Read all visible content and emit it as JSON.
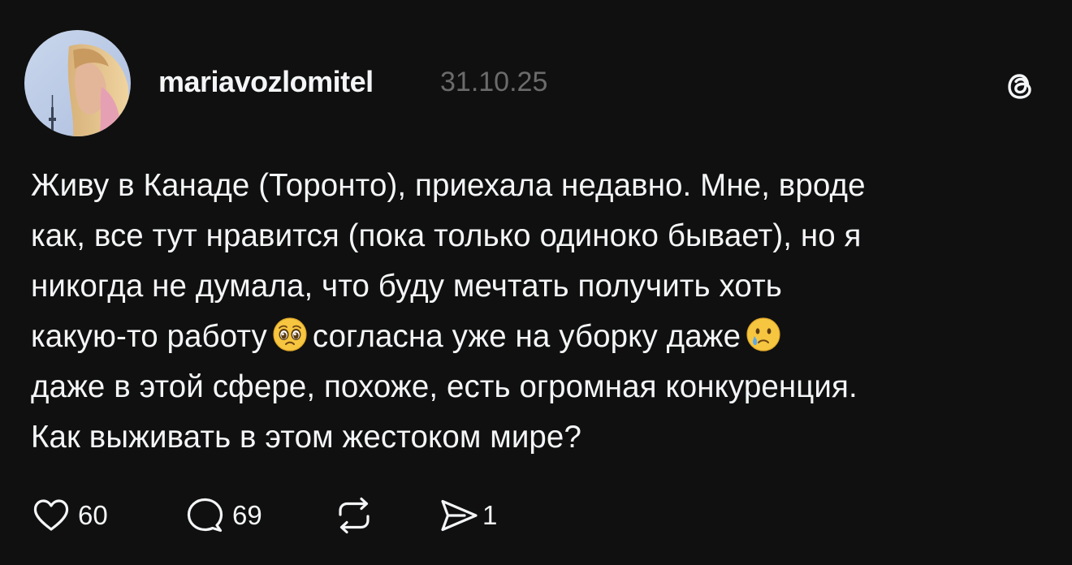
{
  "post": {
    "username": "mariavozlomitel",
    "date": "31.10.25",
    "text_lines": [
      "Живу в Канаде (Торонто), приехала недавно. Мне, вроде",
      "как, все тут нравится (пока только одиноко бывает), но я",
      "никогда не думала, что буду мечтать получить хоть"
    ],
    "line4_part1": "какую-то работу",
    "line4_part2": "согласна уже на уборку даже",
    "text_lines_end": [
      "даже в этой сфере, похоже, есть огромная конкуренция.",
      "Как выживать в этом жестоком мире?"
    ],
    "emoji_1": "pleading-face",
    "emoji_2": "crying-face"
  },
  "actions": {
    "likes": "60",
    "replies": "69",
    "shares": "1"
  },
  "icons": {
    "brand": "threads-logo-icon",
    "like": "heart-icon",
    "reply": "comment-icon",
    "repost": "repost-icon",
    "share": "send-icon"
  },
  "colors": {
    "background": "#101010",
    "text": "#f3f5f7",
    "muted": "#6b6b6b"
  }
}
